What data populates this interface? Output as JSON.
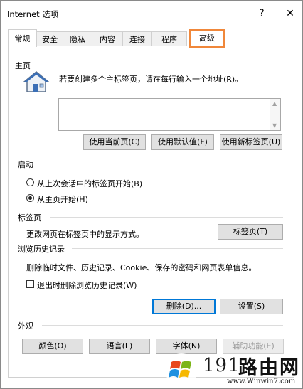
{
  "window": {
    "title": "Internet 选项",
    "help_label": "?",
    "close_label": "✕"
  },
  "tabs": [
    {
      "label": "常规",
      "active": true
    },
    {
      "label": "安全"
    },
    {
      "label": "隐私"
    },
    {
      "label": "内容"
    },
    {
      "label": "连接"
    },
    {
      "label": "程序"
    },
    {
      "label": "高级",
      "highlighted": true
    }
  ],
  "home": {
    "section_title": "主页",
    "instruction": "若要创建多个主标签页，请在每行输入一个地址(R)。",
    "address_value": "",
    "buttons": {
      "use_current": "使用当前页(C)",
      "use_default": "使用默认值(F)",
      "use_new_tab": "使用新标签页(U)"
    },
    "icon": "house-icon"
  },
  "startup": {
    "section_title": "启动",
    "option_last_session": "从上次会话中的标签页开始(B)",
    "option_home": "从主页开始(H)",
    "selected": "option_home"
  },
  "tabs_section": {
    "section_title": "标签页",
    "description": "更改网页在标签页中的显示方式。",
    "button": "标签页(T)"
  },
  "history": {
    "section_title": "浏览历史记录",
    "description": "删除临时文件、历史记录、Cookie、保存的密码和网页表单信息。",
    "checkbox_label": "退出时删除浏览历史记录(W)",
    "checkbox_checked": false,
    "delete_button": "删除(D)...",
    "settings_button": "设置(S)"
  },
  "appearance": {
    "section_title": "外观",
    "colors_button": "颜色(O)",
    "languages_button": "语言(L)",
    "fonts_button": "字体(N)",
    "accessibility_button": "辅助功能(E)"
  },
  "watermark": {
    "number": "191",
    "brand": "路由网",
    "url": "www.Winwin7.com"
  }
}
